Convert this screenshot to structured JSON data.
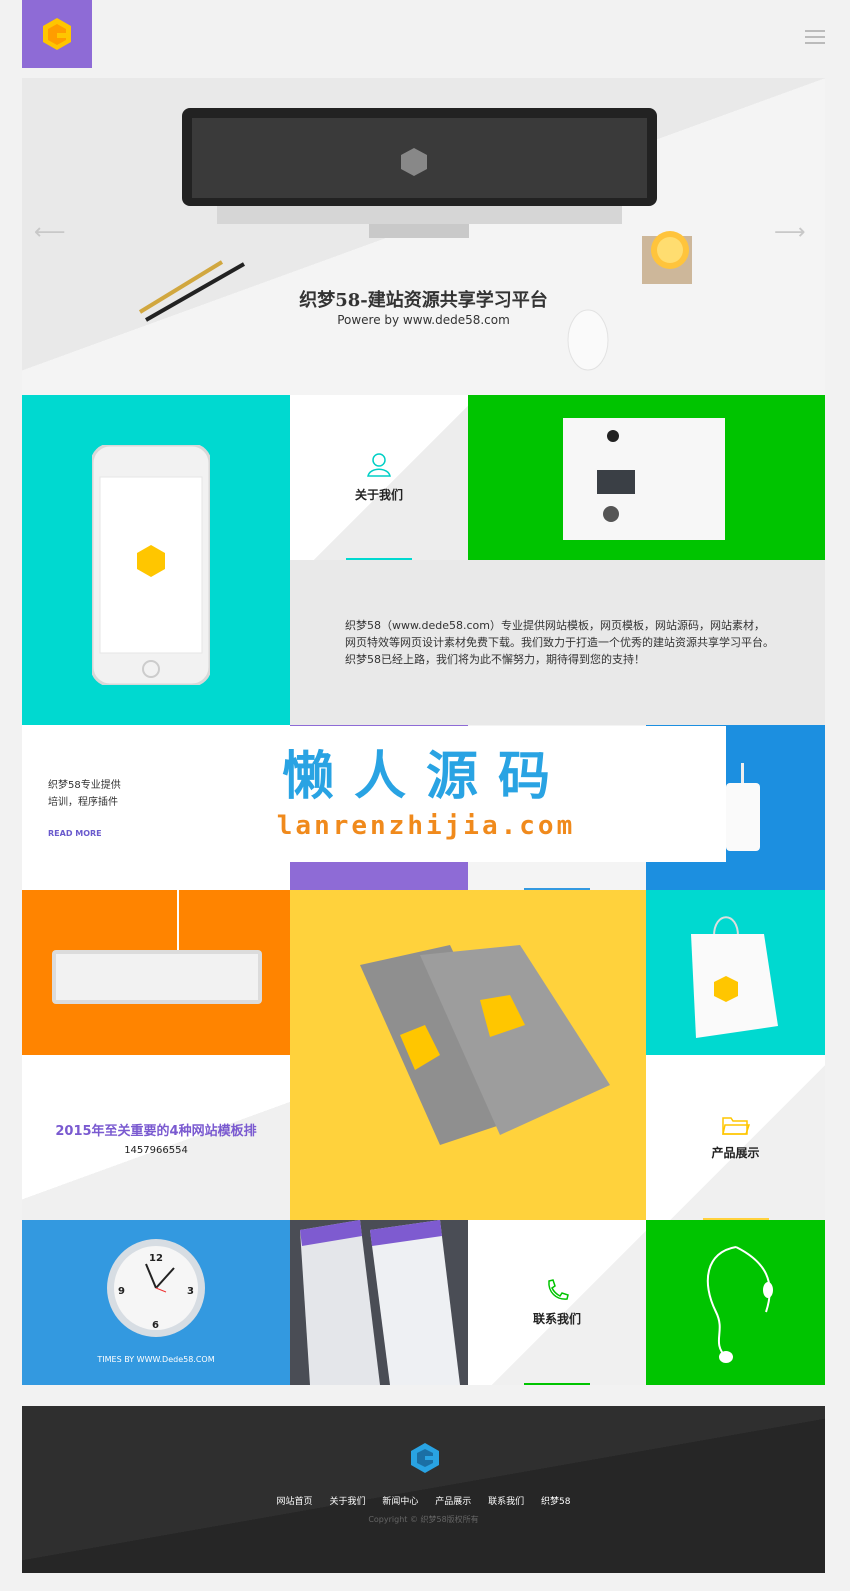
{
  "header": {
    "logo_icon": "g-logo-icon",
    "menu_icon": "hamburger-icon"
  },
  "hero": {
    "title": "织梦58-建站资源共享学习平台",
    "subtitle": "Powere by www.dede58.com",
    "prev_icon": "arrow-left-icon",
    "next_icon": "arrow-right-icon"
  },
  "about": {
    "label": "关于我们",
    "icon": "user-icon",
    "text": "织梦58（www.dede58.com）专业提供网站模板，网页模板，网站源码，网站素材，网页特效等网页设计素材免费下载。我们致力于打造一个优秀的建站资源共享学习平台。织梦58已经上路，我们将为此不懈努力，期待得到您的支持！"
  },
  "news": {
    "text_line1": "织梦58专业提供",
    "text_line2": "培训，程序插件",
    "read_more": "READ MORE"
  },
  "watermark": {
    "line1": "懒人源码",
    "line2": "lanrenzhijia.com"
  },
  "article": {
    "title": "2015年至关重要的4种网站模板排",
    "phone": "1457966554"
  },
  "products": {
    "label": "产品展示",
    "icon": "folder-icon"
  },
  "clock": {
    "caption": "TIMES BY WWW.Dede58.COM",
    "n12": "12",
    "n3": "3",
    "n6": "6",
    "n9": "9"
  },
  "contact": {
    "label": "联系我们",
    "icon": "phone-icon"
  },
  "footer": {
    "nav": [
      "网站首页",
      "关于我们",
      "新闻中心",
      "产品展示",
      "联系我们",
      "织梦58"
    ],
    "copyright": "Copyright © 织梦58版权所有"
  },
  "colors": {
    "purple": "#8e6bd6",
    "cyan": "#00d9d0",
    "green": "#00c400",
    "orange": "#ff8400",
    "yellow": "#ffd23c",
    "blue": "#3399e0"
  }
}
